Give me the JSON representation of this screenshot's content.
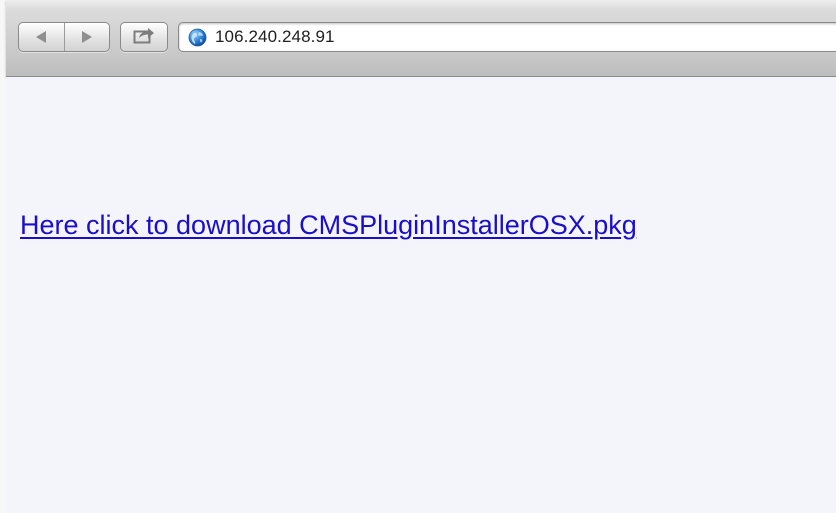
{
  "toolbar": {
    "back_icon": "back-arrow-icon",
    "forward_icon": "forward-arrow-icon",
    "share_icon": "share-icon"
  },
  "address_bar": {
    "site_icon": "globe-icon",
    "url": "106.240.248.91"
  },
  "page": {
    "link_text": "Here click to download CMSPluginInstallerOSX.pkg",
    "link_color": "#1a0dcc",
    "background_color": "#f4f5fb"
  }
}
